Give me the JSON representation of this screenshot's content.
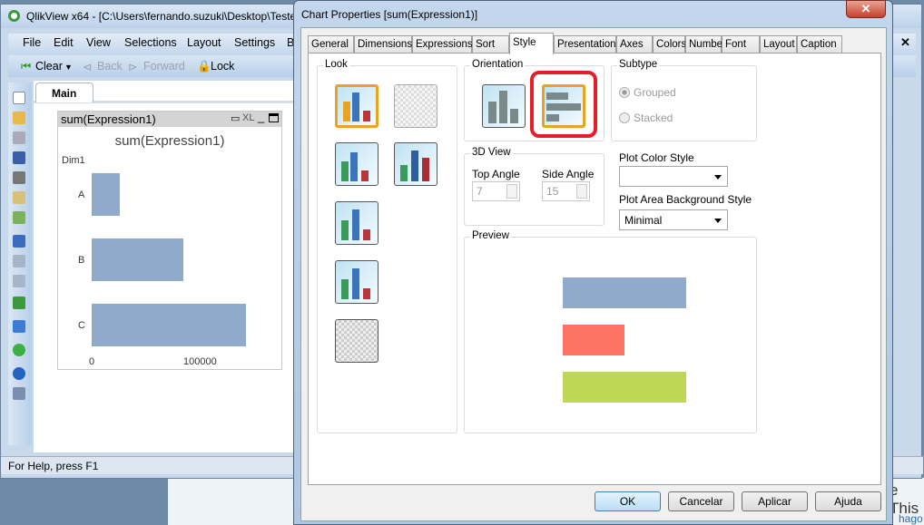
{
  "background": {
    "text1": "e This",
    "text2": "hago"
  },
  "qlikview": {
    "title": "QlikView x64 - [C:\\Users\\fernando.suzuki\\Desktop\\Teste",
    "menu": [
      "File",
      "Edit",
      "View",
      "Selections",
      "Layout",
      "Settings",
      "B"
    ],
    "toolbar": {
      "clear": "Clear",
      "back": "Back",
      "forward": "Forward",
      "lock": "Lock"
    },
    "sheet_tab": "Main",
    "chart": {
      "caption": "sum(Expression1)",
      "caption_icons": [
        "print-icon",
        "XL",
        "minimize-icon",
        "maximize-icon"
      ],
      "xl": "XL",
      "title": "sum(Expression1)",
      "dim_label": "Dim1",
      "categories": [
        "A",
        "B",
        "C"
      ],
      "axis_ticks": [
        "0",
        "100000"
      ]
    },
    "status": "For Help, press F1"
  },
  "chart_data": {
    "type": "bar",
    "orientation": "horizontal",
    "title": "sum(Expression1)",
    "ylabel": "Dim1",
    "categories": [
      "A",
      "B",
      "C"
    ],
    "values": [
      25000,
      83000,
      139000
    ],
    "xticks": [
      "0",
      "100000"
    ],
    "color": "#8faacb"
  },
  "dialog": {
    "title": "Chart Properties [sum(Expression1)]",
    "tabs": [
      "General",
      "Dimensions",
      "Expressions",
      "Sort",
      "Style",
      "Presentation",
      "Axes",
      "Colors",
      "Number",
      "Font",
      "Layout",
      "Caption"
    ],
    "active_tab": "Style",
    "look_label": "Look",
    "orientation_label": "Orientation",
    "orientation_selected": "horizontal",
    "subtype_label": "Subtype",
    "subtype_options": [
      "Grouped",
      "Stacked"
    ],
    "subtype_selected": "Grouped",
    "view3d_label": "3D View",
    "top_angle_label": "Top Angle",
    "top_angle": "7",
    "side_angle_label": "Side Angle",
    "side_angle": "15",
    "plot_color_label": "Plot Color Style",
    "plot_color_value": "",
    "plot_bg_label": "Plot Area Background Style",
    "plot_bg_value": "Minimal",
    "preview_label": "Preview",
    "preview_colors": [
      "#8faacb",
      "#fd7465",
      "#bed754"
    ],
    "highlight_color": "#e2202a",
    "buttons": {
      "ok": "OK",
      "cancel": "Cancelar",
      "apply": "Aplicar",
      "help": "Ajuda"
    }
  }
}
